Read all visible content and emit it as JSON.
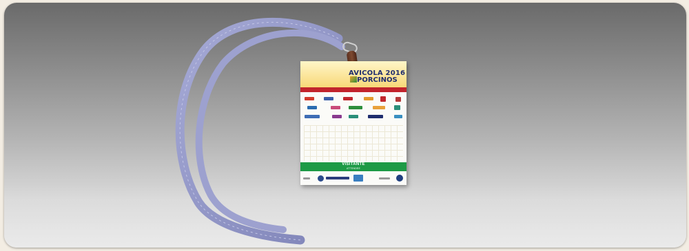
{
  "photo": {
    "subject": "Event badge on lanyard"
  },
  "badge": {
    "event_title_line1": "AVICOLA 2016",
    "event_title_line2": "PORCINOS",
    "role_label": "VISITANTE",
    "role_sublabel": "ATTENDEE"
  },
  "colors": {
    "lanyard": "#8f94c4",
    "header": "#f8d878",
    "red_bar": "#c2242c",
    "green_bar": "#1d9a46",
    "title": "#1f2d6e"
  }
}
